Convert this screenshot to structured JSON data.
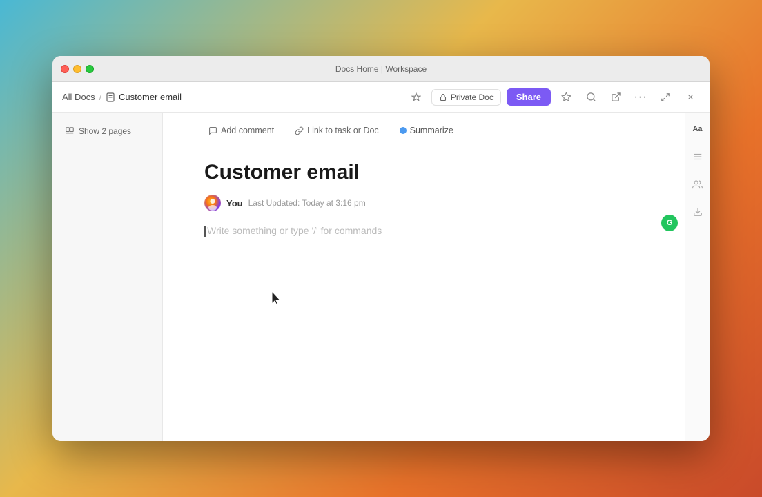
{
  "window": {
    "title": "Docs Home | Workspace",
    "traffic_lights": {
      "close": "close",
      "minimize": "minimize",
      "maximize": "maximize"
    }
  },
  "toolbar": {
    "breadcrumb": {
      "all_docs": "All Docs",
      "separator": "/",
      "current": "Customer email"
    },
    "buttons": {
      "private_doc": "Private Doc",
      "share": "Share",
      "more": "···",
      "close": "✕",
      "expand": "⤢",
      "export": "↗"
    },
    "icons": {
      "lock": "🔒",
      "star": "☆",
      "search": "⌕",
      "export_arrow": "↗",
      "more": "…",
      "expand": "⤢",
      "close": "✕"
    }
  },
  "sidebar": {
    "show_pages": "Show 2 pages",
    "pages_icon": "□"
  },
  "doc_toolbar": {
    "add_comment": "Add comment",
    "link_task": "Link to task or Doc",
    "summarize": "Summarize"
  },
  "document": {
    "title": "Customer email",
    "author": "You",
    "last_updated_label": "Last Updated:",
    "last_updated": "Today at 3:16 pm",
    "placeholder": "Write something or type '/' for commands"
  },
  "right_panel": {
    "icons": [
      "Aa",
      "⧖",
      "👤",
      "↓"
    ]
  },
  "green_circle": {
    "letter": "G"
  }
}
